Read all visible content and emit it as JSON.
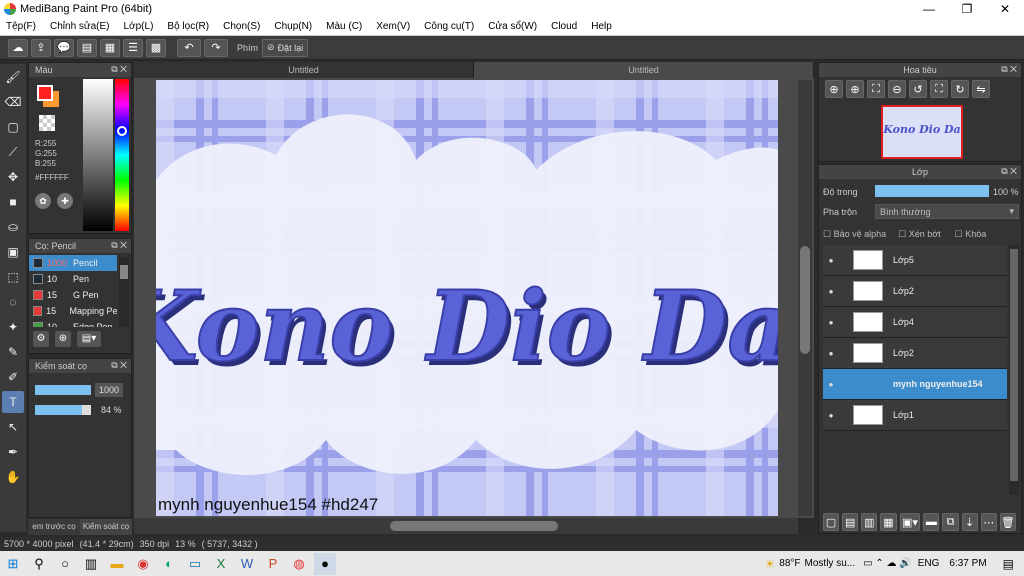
{
  "window": {
    "title": "MediBang Paint Pro (64bit)",
    "minimize": "—",
    "maximize": "❐",
    "close": "✕"
  },
  "menu": [
    "Tệp(F)",
    "Chỉnh sửa(E)",
    "Lớp(L)",
    "Bộ lọc(R)",
    "Chọn(S)",
    "Chụp(N)",
    "Màu (C)",
    "Xem(V)",
    "Công cụ(T)",
    "Cửa sổ(W)",
    "Cloud",
    "Help"
  ],
  "toolbar": {
    "shortcut_label": "Phím",
    "reset_label": "Đặt lại"
  },
  "tabs": [
    "Untitled",
    "Untitled"
  ],
  "color_panel": {
    "title": "Màu",
    "rgb_r": "R:255",
    "rgb_g": "G:255",
    "rgb_b": "B:255",
    "hex": "#FFFFFF",
    "fg_color": "#ff2020",
    "bg_color": "#ff9a30"
  },
  "brush_panel": {
    "title": "Cọ: Pencil",
    "items": [
      {
        "size": "1000",
        "name": "Pencil",
        "color": "#1c2a3a"
      },
      {
        "size": "10",
        "name": "Pen",
        "color": "#1c2a3a"
      },
      {
        "size": "15",
        "name": "G Pen",
        "color": "#e53935"
      },
      {
        "size": "15",
        "name": "Mapping Pen",
        "color": "#e53935"
      },
      {
        "size": "10",
        "name": "Edge Pen",
        "color": "#43a047"
      }
    ]
  },
  "brush_control": {
    "title": "Kiểm soát cọ",
    "size_value": "1000",
    "opacity_value": "84 %",
    "opacity_fraction": 0.84
  },
  "bottom_left_tabs": [
    "em trước cọ",
    "Kiểm soát cọ"
  ],
  "navigator": {
    "title": "Hoa tiêu"
  },
  "layer_panel": {
    "title": "Lớp",
    "opacity_label": "Độ trong",
    "opacity_value": "100 %",
    "blend_label": "Pha trộn",
    "blend_value": "Bình thường",
    "protect_alpha": "Bảo vệ alpha",
    "clipping": "Xén bớt",
    "lock": "Khóa",
    "layers": [
      {
        "name": "Lớp5"
      },
      {
        "name": "Lớp2"
      },
      {
        "name": "Lớp4"
      },
      {
        "name": "Lớp2"
      },
      {
        "name": "mynh  nguyenhue154"
      },
      {
        "name": "Lớp1"
      }
    ]
  },
  "artwork": {
    "title_text": "Kono Dio Da",
    "signature": "mynh  nguyenhue154   #hd247"
  },
  "status": {
    "size": "5700 * 4000 pixel",
    "cm": "(41.4 * 29cm)",
    "dpi": "350 dpi",
    "zoom": "13 %",
    "cursor": "( 5737, 3432 )"
  },
  "taskbar": {
    "weather_temp": "88°F",
    "weather_desc": "Mostly su...",
    "lang": "ENG",
    "time": "6:37 PM"
  }
}
